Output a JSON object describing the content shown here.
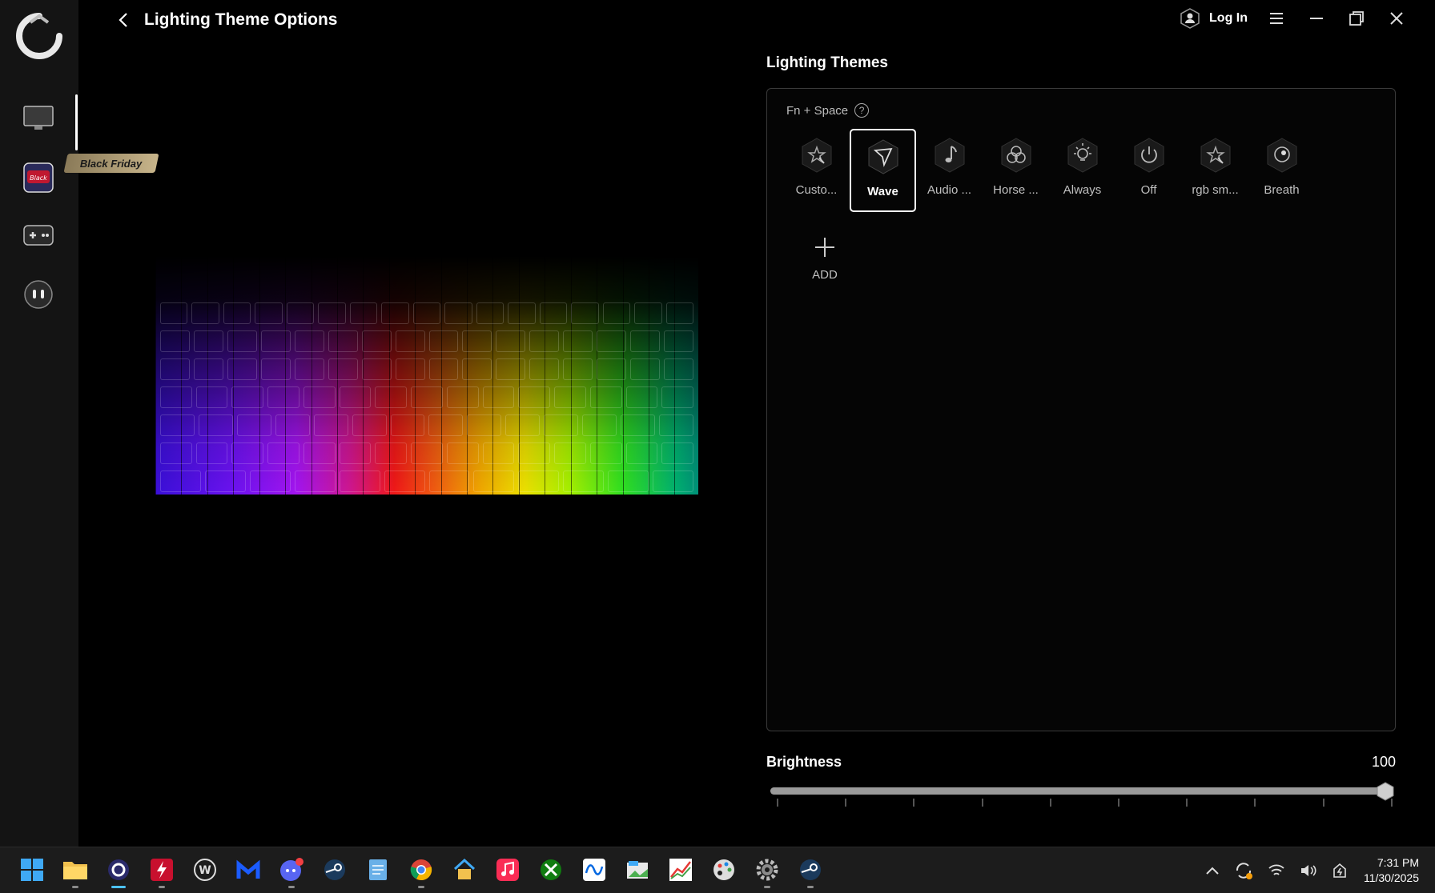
{
  "header": {
    "title": "Lighting Theme Options",
    "login_label": "Log In"
  },
  "sidebar": {
    "items": [
      {
        "name": "monitor"
      },
      {
        "name": "black-friday",
        "tag": "Black Friday"
      },
      {
        "name": "gamepad"
      },
      {
        "name": "robot"
      }
    ]
  },
  "themes": {
    "heading": "Lighting Themes",
    "shortcut": "Fn + Space",
    "selected": "Wave",
    "items": [
      {
        "label": "Custo...",
        "icon": "star-cursor-icon"
      },
      {
        "label": "Wave",
        "icon": "wave-arrow-icon"
      },
      {
        "label": "Audio ...",
        "icon": "music-note-icon"
      },
      {
        "label": "Horse ...",
        "icon": "rgb-circles-icon"
      },
      {
        "label": "Always",
        "icon": "bulb-icon"
      },
      {
        "label": "Off",
        "icon": "power-icon"
      },
      {
        "label": "rgb sm...",
        "icon": "star-cursor-icon"
      },
      {
        "label": "Breath",
        "icon": "breath-icon"
      }
    ],
    "add_label": "ADD"
  },
  "brightness": {
    "label": "Brightness",
    "value": 100,
    "value_text": "100"
  },
  "taskbar": {
    "time": "7:31 PM",
    "date": "11/30/2025",
    "apps": [
      "windows-start",
      "file-explorer",
      "lighting-app",
      "flash",
      "wordpress",
      "malwarebytes",
      "discord",
      "steam",
      "notepad",
      "chrome",
      "home",
      "music",
      "xbox",
      "meta",
      "photos",
      "stocks",
      "paint",
      "settings",
      "steam-2"
    ]
  },
  "colors": {
    "accent": "#4cc2ff",
    "background": "#000000",
    "sidebar": "#141414"
  }
}
